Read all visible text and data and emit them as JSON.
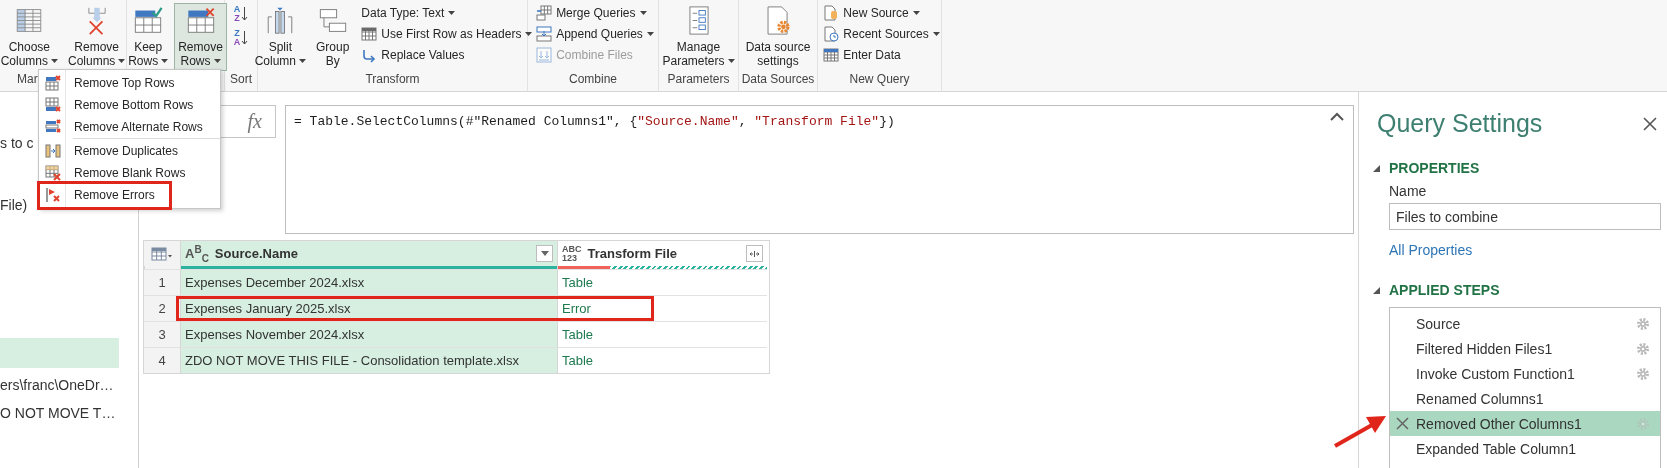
{
  "ribbon": {
    "groups": [
      {
        "label": "Mar",
        "items": [
          {
            "kind": "large",
            "lines": [
              "Choose",
              "Columns"
            ],
            "dropdown": true,
            "pressed": false
          },
          {
            "kind": "large",
            "lines": [
              "Remove",
              "Columns"
            ],
            "dropdown": true,
            "pressed": false
          }
        ]
      },
      {
        "items": [
          {
            "kind": "large",
            "lines": [
              "Keep",
              "Rows"
            ],
            "dropdown": true,
            "pressed": false
          },
          {
            "kind": "large",
            "lines": [
              "Remove",
              "Rows"
            ],
            "dropdown": true,
            "pressed": true
          }
        ]
      },
      {
        "label": "Sort",
        "items": [
          {
            "kind": "sort",
            "letters": [
              "A",
              "Z"
            ]
          },
          {
            "kind": "sort",
            "letters": [
              "Z",
              "A"
            ]
          }
        ]
      },
      {
        "label": "Transform",
        "items": [
          {
            "kind": "large",
            "lines": [
              "Split",
              "Column"
            ],
            "dropdown": true,
            "pressed": false
          },
          {
            "kind": "large",
            "lines": [
              "Group",
              "By"
            ],
            "dropdown": false,
            "pressed": false
          },
          {
            "kind": "stack",
            "entries": [
              {
                "label": "Data Type: Text",
                "dropdown": true,
                "disabled": false
              },
              {
                "label": "Use First Row as Headers",
                "dropdown": true,
                "disabled": false
              },
              {
                "label": "Replace Values",
                "dropdown": false,
                "disabled": false
              }
            ]
          }
        ]
      },
      {
        "label": "Combine",
        "items": [
          {
            "kind": "stack",
            "entries": [
              {
                "label": "Merge Queries",
                "dropdown": true,
                "disabled": false
              },
              {
                "label": "Append Queries",
                "dropdown": true,
                "disabled": false
              },
              {
                "label": "Combine Files",
                "dropdown": false,
                "disabled": true
              }
            ]
          }
        ]
      },
      {
        "label": "Parameters",
        "items": [
          {
            "kind": "large",
            "lines": [
              "Manage",
              "Parameters"
            ],
            "dropdown": true,
            "pressed": false
          }
        ]
      },
      {
        "label": "Data Sources",
        "items": [
          {
            "kind": "large",
            "lines": [
              "Data source",
              "settings"
            ],
            "dropdown": false,
            "pressed": false
          }
        ]
      },
      {
        "label": "New Query",
        "items": [
          {
            "kind": "stack",
            "entries": [
              {
                "label": "New Source",
                "dropdown": true,
                "disabled": false
              },
              {
                "label": "Recent Sources",
                "dropdown": true,
                "disabled": false
              },
              {
                "label": "Enter Data",
                "dropdown": false,
                "disabled": false
              }
            ]
          }
        ]
      }
    ]
  },
  "menu": {
    "sections": [
      [
        {
          "label": "Remove Top Rows",
          "annotated": false
        },
        {
          "label": "Remove Bottom Rows",
          "annotated": false
        },
        {
          "label": "Remove Alternate Rows",
          "annotated": false
        }
      ],
      [
        {
          "label": "Remove Duplicates",
          "annotated": false
        },
        {
          "label": "Remove Blank Rows",
          "annotated": false
        },
        {
          "label": "Remove Errors",
          "annotated": true
        }
      ]
    ]
  },
  "queries_pane": {
    "items": [
      {
        "text": "s to c",
        "selected": false
      },
      {
        "text": "File)",
        "selected": false
      },
      {
        "selected": true
      },
      {
        "text": "ers\\franc\\OneDr…",
        "selected": false
      },
      {
        "text": "O NOT MOVE T…",
        "selected": false
      }
    ]
  },
  "formula_bar": {
    "fx": "fx",
    "formula": [
      {
        "kind": "code",
        "text": "= Table.SelectColumns(#\"Renamed Columns1\", {"
      },
      {
        "kind": "string",
        "text": "\"Source.Name\""
      },
      {
        "kind": "code",
        "text": ", "
      },
      {
        "kind": "string",
        "text": "\"Transform File\""
      },
      {
        "kind": "code",
        "text": "})"
      }
    ]
  },
  "table": {
    "columns": [
      {
        "name": "Source.Name",
        "type_lines": [
          "A$^{B}$$_{C}$"
        ],
        "selected": true,
        "errors": {
          "level": 0
        },
        "hatched": false
      },
      {
        "name": "Transform File",
        "type_lines": [
          "ABC",
          "123"
        ],
        "selected": false,
        "errors": {
          "level": 0.25
        },
        "hatched": true
      }
    ],
    "rows": [
      {
        "index": "1",
        "cells": [
          "Expenses December 2024.xlsx",
          "Table"
        ],
        "annotated": false
      },
      {
        "index": "2",
        "cells": [
          "Expenses January 2025.xlsx",
          "Error"
        ],
        "annotated": true
      },
      {
        "index": "3",
        "cells": [
          "Expenses November 2024.xlsx",
          "Table"
        ],
        "annotated": false
      },
      {
        "index": "4",
        "cells": [
          "ZDO NOT MOVE THIS FILE - Consolidation template.xlsx",
          "Table"
        ],
        "annotated": false
      }
    ]
  },
  "query_settings": {
    "title": "Query Settings",
    "properties": {
      "title": "PROPERTIES",
      "expanded": true,
      "name_label": "Name",
      "name_value": "Files to combine",
      "link": "All Properties"
    },
    "applied_steps": {
      "title": "APPLIED STEPS",
      "expanded": true,
      "steps": [
        {
          "label": "Source",
          "settings": true,
          "selected": false,
          "annotated": false
        },
        {
          "label": "Filtered Hidden Files1",
          "settings": true,
          "selected": false,
          "annotated": false
        },
        {
          "label": "Invoke Custom Function1",
          "settings": true,
          "selected": false,
          "annotated": false
        },
        {
          "label": "Renamed Columns1",
          "settings": false,
          "selected": false,
          "annotated": false
        },
        {
          "label": "Removed Other Columns1",
          "settings": true,
          "selected": true,
          "annotated": true
        },
        {
          "label": "Expanded Table Column1",
          "settings": false,
          "selected": false,
          "annotated": false
        }
      ]
    }
  }
}
